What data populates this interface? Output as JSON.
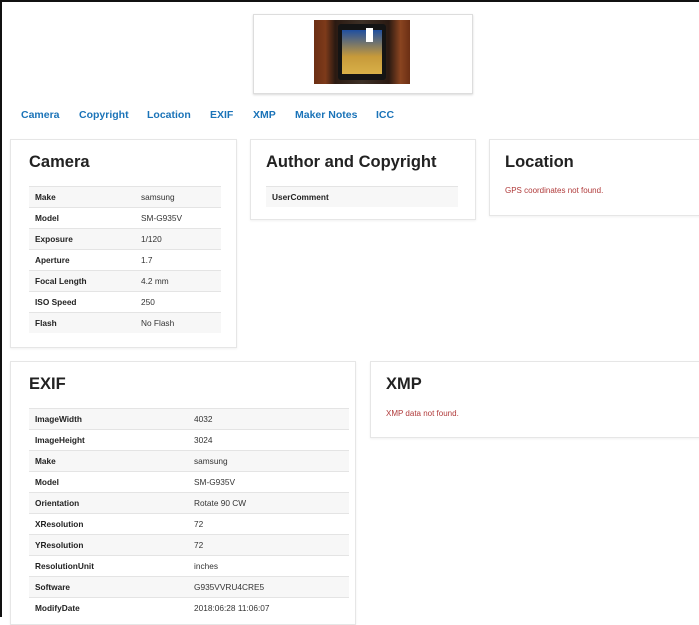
{
  "nav": [
    "Camera",
    "Copyright",
    "Location",
    "EXIF",
    "XMP",
    "Maker Notes",
    "ICC"
  ],
  "camera": {
    "title": "Camera",
    "rows": [
      [
        "Make",
        "samsung"
      ],
      [
        "Model",
        "SM-G935V"
      ],
      [
        "Exposure",
        "1/120"
      ],
      [
        "Aperture",
        "1.7"
      ],
      [
        "Focal Length",
        "4.2 mm"
      ],
      [
        "ISO Speed",
        "250"
      ],
      [
        "Flash",
        "No Flash"
      ]
    ]
  },
  "copyright": {
    "title": "Author and Copyright",
    "rows": [
      [
        "UserComment",
        ""
      ]
    ]
  },
  "location": {
    "title": "Location",
    "message": "GPS coordinates not found."
  },
  "exif": {
    "title": "EXIF",
    "rows": [
      [
        "ImageWidth",
        "4032"
      ],
      [
        "ImageHeight",
        "3024"
      ],
      [
        "Make",
        "samsung"
      ],
      [
        "Model",
        "SM-G935V"
      ],
      [
        "Orientation",
        "Rotate 90 CW"
      ],
      [
        "XResolution",
        "72"
      ],
      [
        "YResolution",
        "72"
      ],
      [
        "ResolutionUnit",
        "inches"
      ],
      [
        "Software",
        "G935VVRU4CRE5"
      ],
      [
        "ModifyDate",
        "2018:06:28 11:06:07"
      ]
    ]
  },
  "xmp": {
    "title": "XMP",
    "message": "XMP data not found."
  }
}
